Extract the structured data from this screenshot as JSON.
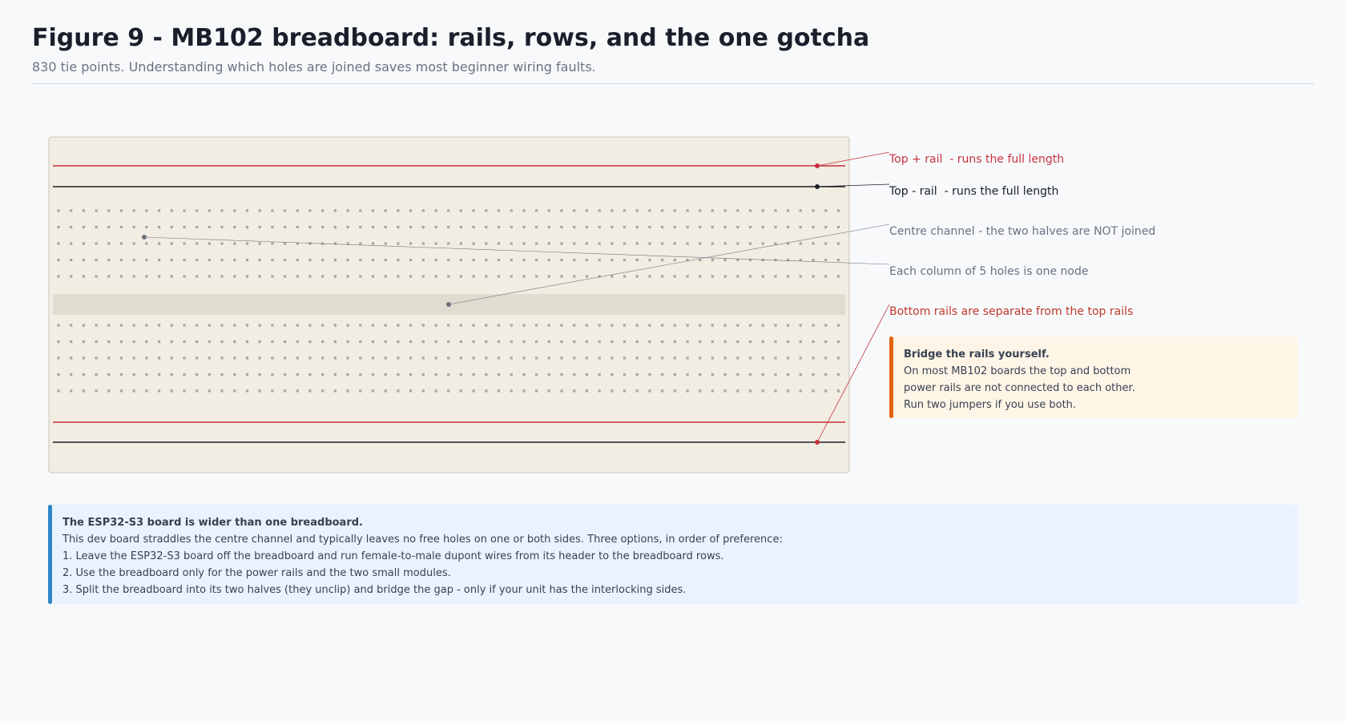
{
  "header": {
    "title": "Figure 9 - MB102 breadboard: rails, rows, and the one gotcha",
    "subtitle": "830 tie points. Understanding which holes are joined saves most beginner wiring faults."
  },
  "breadboard": {
    "columns": 63,
    "rows_per_half": 5,
    "colors": {
      "board_fill": "#f2ede2",
      "board_border": "#c9c4b8",
      "channel": "#e0dccf",
      "hole": "#a8a59e",
      "plus_rail": "#c8323c",
      "minus_rail": "#1a1f2b",
      "leader_red": "#c8323c",
      "leader_grey": "#6b7280"
    }
  },
  "annotations": [
    {
      "id": "top-plus",
      "text": "Top + rail  - runs the full length",
      "color": "#c8323c"
    },
    {
      "id": "top-minus",
      "text": "Top - rail  - runs the full length",
      "color": "#1a1f2b"
    },
    {
      "id": "centre-channel",
      "text": "Centre channel - the two halves are NOT joined",
      "color": "#6b7280"
    },
    {
      "id": "column-node",
      "text": "Each column of 5 holes is one node",
      "color": "#6b7280"
    },
    {
      "id": "bottom-rails",
      "text": "Bottom rails are separate from the top rails",
      "color": "#c0392b"
    }
  ],
  "callout": {
    "heading": "Bridge the rails yourself.",
    "lines": [
      "On most MB102 boards the top and bottom",
      "power rails are not connected to each other.",
      "Run two jumpers if you use both."
    ],
    "accent": "#e0640f"
  },
  "note": {
    "heading": "The ESP32-S3 board is wider than one breadboard.",
    "lines": [
      "This dev board straddles the centre channel and typically leaves no free holes on one or both sides. Three options, in order of preference:",
      "1. Leave the ESP32-S3 board off the breadboard and run female-to-male dupont wires from its header to the breadboard rows.",
      "2. Use the breadboard only for the power rails and the two small modules.",
      "3. Split the breadboard into its two halves (they unclip) and bridge the gap - only if your unit has the interlocking sides."
    ],
    "accent": "#2d86c6"
  }
}
